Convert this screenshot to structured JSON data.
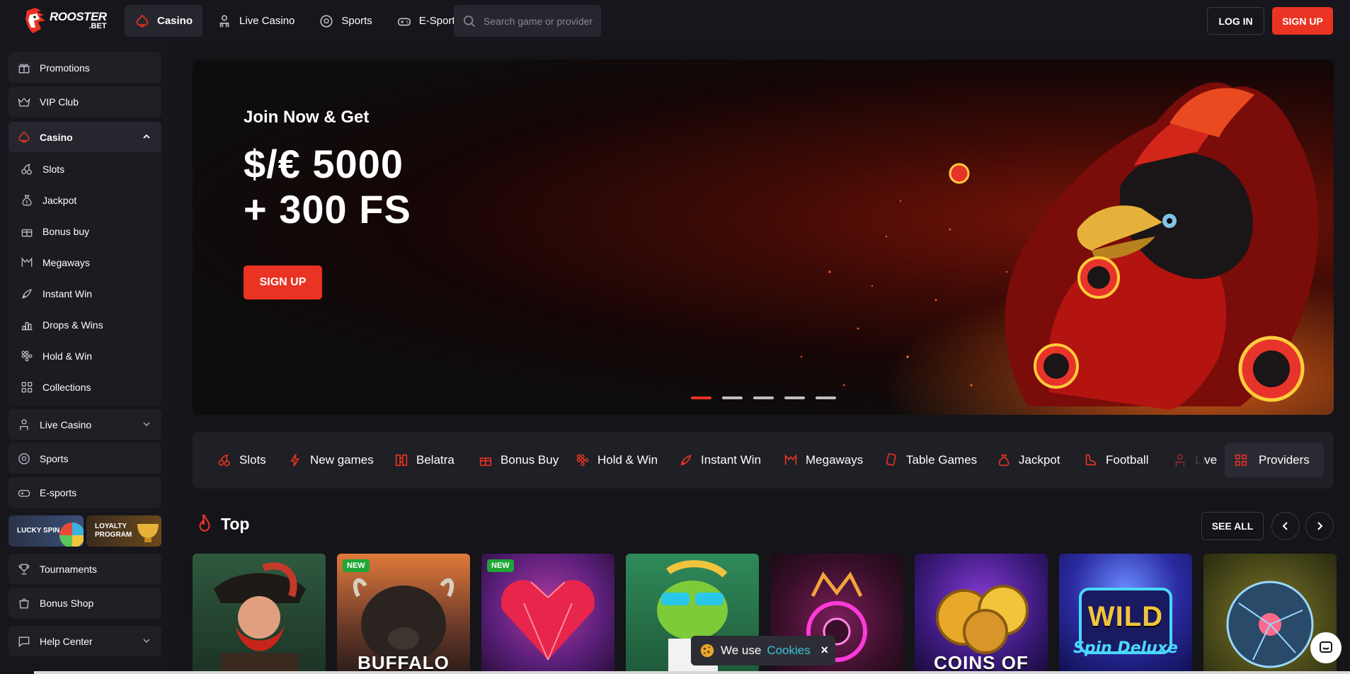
{
  "brand": {
    "logo_line1": "ROOSTER",
    "logo_line2": ".BET",
    "accent": "#ea3322"
  },
  "topnav": [
    {
      "label": "Casino",
      "icon": "spade-icon",
      "active": true
    },
    {
      "label": "Live Casino",
      "icon": "dealer-icon"
    },
    {
      "label": "Sports",
      "icon": "soccer-ball-icon"
    },
    {
      "label": "E-Sports",
      "icon": "gamepad-icon"
    }
  ],
  "search": {
    "placeholder": "Search game or provider"
  },
  "auth": {
    "login": "LOG IN",
    "signup": "SIGN UP"
  },
  "sidebar": {
    "promotions": "Promotions",
    "vip": "VIP Club",
    "casino": {
      "label": "Casino",
      "items": [
        "Slots",
        "Jackpot",
        "Bonus buy",
        "Megaways",
        "Instant Win",
        "Drops & Wins",
        "Hold & Win",
        "Collections"
      ]
    },
    "live_casino": "Live Casino",
    "sports": "Sports",
    "esports": "E-sports",
    "lucky_spin": "LUCKY SPIN",
    "loyalty_1": "LOYALTY",
    "loyalty_2": "PROGRAM",
    "tournaments": "Tournaments",
    "bonus_shop": "Bonus Shop",
    "help_center": "Help Center"
  },
  "hero": {
    "title": "Join Now & Get",
    "line1": "$/€ 5000",
    "line2": "+ 300 FS",
    "button": "SIGN UP",
    "slide_count": 5,
    "active_slide": 1
  },
  "categories": [
    "Slots",
    "New games",
    "Belatra",
    "Bonus Buy",
    "Hold & Win",
    "Instant Win",
    "Megaways",
    "Table Games",
    "Jackpot",
    "Football",
    "Live"
  ],
  "providers_label": "Providers",
  "top_section": {
    "title": "Top",
    "see_all": "SEE ALL"
  },
  "games": [
    {
      "badge": "",
      "title": ""
    },
    {
      "badge": "NEW",
      "title": "BUFFALO"
    },
    {
      "badge": "NEW",
      "title": ""
    },
    {
      "badge": "",
      "title": ""
    },
    {
      "badge": "",
      "title": ""
    },
    {
      "badge": "",
      "title": "COINS OF"
    },
    {
      "badge": "",
      "title": "WILD"
    },
    {
      "badge": "",
      "title": ""
    }
  ],
  "cookie": {
    "text": "We use",
    "link": "Cookies",
    "close": "×"
  }
}
